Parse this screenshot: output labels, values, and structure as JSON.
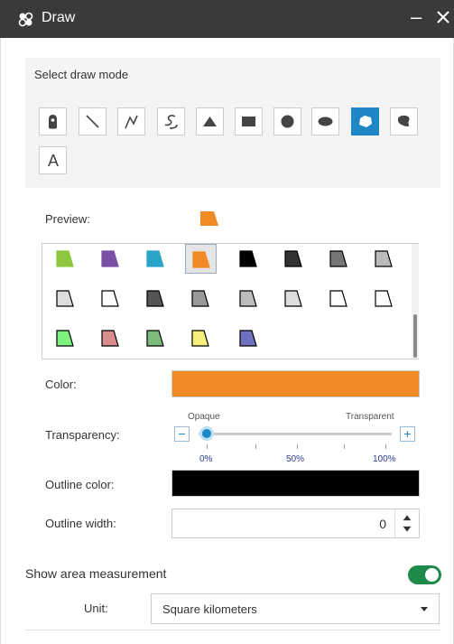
{
  "window": {
    "title": "Draw",
    "minimize_label": "–",
    "icon": "draw-widget-icon",
    "close_icon": "close-icon"
  },
  "draw_mode": {
    "label": "Select draw mode",
    "tools": [
      {
        "name": "point",
        "icon": "point-icon"
      },
      {
        "name": "line",
        "icon": "line-icon"
      },
      {
        "name": "polyline",
        "icon": "polyline-icon"
      },
      {
        "name": "freehand-polyline",
        "icon": "freehand-polyline-icon"
      },
      {
        "name": "triangle",
        "icon": "triangle-icon"
      },
      {
        "name": "rectangle",
        "icon": "rectangle-icon"
      },
      {
        "name": "circle",
        "icon": "circle-icon"
      },
      {
        "name": "ellipse",
        "icon": "ellipse-icon"
      },
      {
        "name": "polygon",
        "icon": "polygon-icon",
        "active": true
      },
      {
        "name": "freehand-polygon",
        "icon": "freehand-polygon-icon"
      },
      {
        "name": "text",
        "icon": "text-icon",
        "glyph": "A"
      }
    ]
  },
  "preview": {
    "label": "Preview:",
    "color": "#f08a24"
  },
  "symbols": [
    {
      "fill": "#8cc63e",
      "stroke": "#8cc63e"
    },
    {
      "fill": "#7b4ea6",
      "stroke": "#7b4ea6"
    },
    {
      "fill": "#2aa4c9",
      "stroke": "#2aa4c9"
    },
    {
      "fill": "#f08a24",
      "stroke": "#f08a24",
      "selected": true
    },
    {
      "fill": "#000000",
      "stroke": "#000000"
    },
    {
      "fill": "#333333",
      "stroke": "#000000"
    },
    {
      "fill": "#777777",
      "stroke": "#000000"
    },
    {
      "fill": "#bbbbbb",
      "stroke": "#000000"
    },
    {
      "fill": "#dddddd",
      "stroke": "#000000"
    },
    {
      "fill": "#ffffff",
      "stroke": "#000000"
    },
    {
      "fill": "#555555",
      "stroke": "#000000"
    },
    {
      "fill": "#999999",
      "stroke": "#000000"
    },
    {
      "fill": "#bbbbbb",
      "stroke": "#000000"
    },
    {
      "fill": "#dddddd",
      "stroke": "#000000"
    },
    {
      "fill": "#ffffff",
      "stroke": "#000000"
    },
    {
      "fill": "#ffffff",
      "stroke": "#000000"
    },
    {
      "fill": "#7ef27e",
      "stroke": "#000000"
    },
    {
      "fill": "#d98c8c",
      "stroke": "#000000"
    },
    {
      "fill": "#7dbb7d",
      "stroke": "#000000"
    },
    {
      "fill": "#f5f07a",
      "stroke": "#000000"
    },
    {
      "fill": "#7070c0",
      "stroke": "#000000"
    }
  ],
  "color": {
    "label": "Color:",
    "value": "#f08a24"
  },
  "transparency": {
    "label": "Transparency:",
    "left_label": "Opaque",
    "right_label": "Transparent",
    "minus": "−",
    "plus": "+",
    "ticks": [
      "0%",
      "50%",
      "100%"
    ],
    "value": 0
  },
  "outline_color": {
    "label": "Outline color:",
    "value": "#000000"
  },
  "outline_width": {
    "label": "Outline width:",
    "value": "0"
  },
  "area_measurement": {
    "label": "Show area measurement",
    "enabled": true,
    "toggle_color": "#1e8a4a"
  },
  "unit": {
    "label": "Unit:",
    "value": "Square kilometers"
  },
  "accent_color": "#1e88c7"
}
